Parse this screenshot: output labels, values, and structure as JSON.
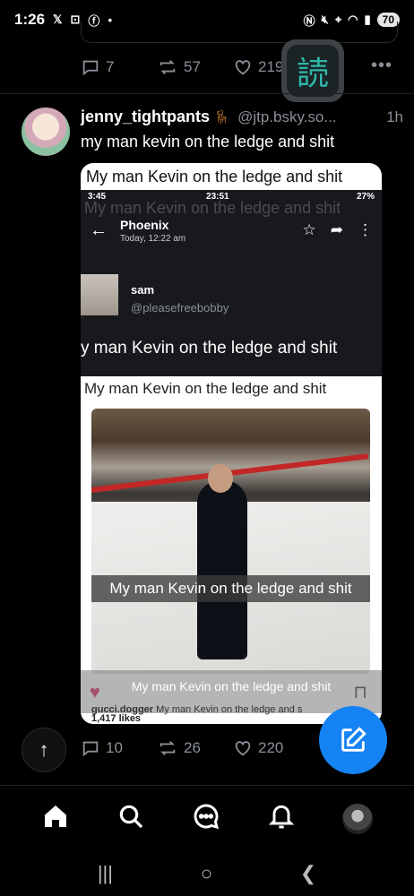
{
  "status_bar": {
    "time": "1:26",
    "left_icons": [
      "x-icon",
      "screen-icon",
      "facebook-icon",
      "dot-icon"
    ],
    "battery": "70"
  },
  "previous_post": {
    "reply_count": "7",
    "repost_count": "57",
    "like_count": "219",
    "kanji_button": "読"
  },
  "post": {
    "author": "jenny_tightpants",
    "author_emoji": "chair-icon",
    "handle": "@jtp.bsky.so...",
    "time": "1h",
    "text": "my man kevin on the ledge and shit",
    "embed": {
      "caption": "My man Kevin on the ledge and shit",
      "inner_status_time": "23:51",
      "inner_status_left": "3:45",
      "inner_battery": "27%",
      "twitter": {
        "chat_title": "Phoenix",
        "chat_subtitle": "Today, 12:22 am",
        "user_name": "sam",
        "user_handle": "@pleasefreebobby",
        "body": "y man Kevin on the ledge and shit"
      },
      "instagram": {
        "caption": "My man Kevin on the ledge and shit",
        "snap_caption": "My man Kevin on the ledge and shit",
        "overlay_caption": "My man Kevin on the ledge and shit",
        "likes": "1,417 likes",
        "user": "gucci.dogger",
        "user_caption": "My man Kevin on the ledge and s"
      }
    },
    "reply_count": "10",
    "repost_count": "26",
    "like_count": "220"
  },
  "accent_color": "#1683f5",
  "tabs": [
    "home-icon",
    "search-icon",
    "chat-icon",
    "bell-icon",
    "profile-avatar"
  ]
}
